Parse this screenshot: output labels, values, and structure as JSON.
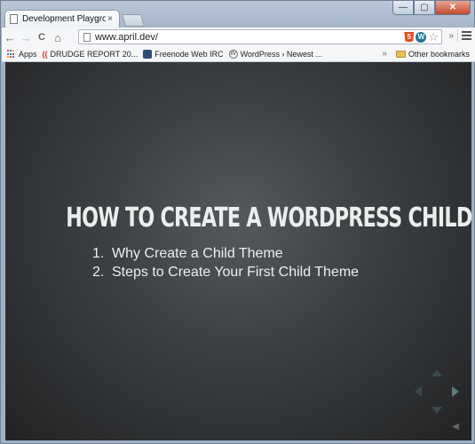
{
  "browser": {
    "tab": {
      "title": "Development Playground",
      "close": "×"
    },
    "window_controls": {
      "minimize": "—",
      "maximize": "▢",
      "close": "✕"
    },
    "toolbar": {
      "back": "←",
      "forward": "→",
      "reload": "C",
      "home": "⌂",
      "address": "www.april.dev/",
      "html5_label": "5",
      "wp_label": "W",
      "star": "☆",
      "overflow": "»"
    },
    "bookmarks": {
      "items": [
        {
          "label": "Apps",
          "icon": "apps-grid-icon"
        },
        {
          "label": "DRUDGE REPORT 20...",
          "icon": "drudge-icon"
        },
        {
          "label": "Freenode Web IRC",
          "icon": "irc-icon"
        },
        {
          "label": "WordPress › Newest ...",
          "icon": "wordpress-icon"
        }
      ],
      "overflow": "»",
      "other": "Other bookmarks"
    }
  },
  "slide": {
    "title": "How to Create a WordPress Child Theme",
    "items": [
      {
        "num": "1.",
        "text": "Why Create a Child Theme"
      },
      {
        "num": "2.",
        "text": "Steps to Create Your First Child Theme"
      }
    ]
  },
  "colors": {
    "slide_background": "#3d4043",
    "slide_text": "#eceeee",
    "nav_arrow_active": "#5e7b76"
  }
}
